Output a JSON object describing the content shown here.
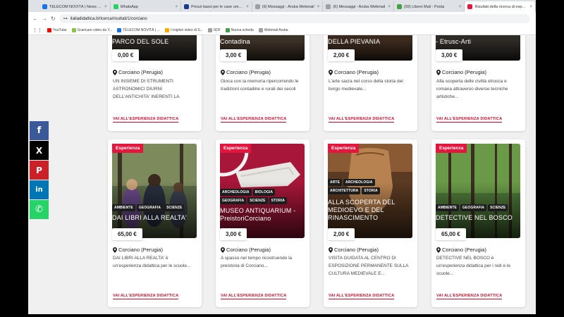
{
  "tabs": [
    {
      "title": "TELECOM NOVITÀ | News Espo...",
      "color": "#1a73e8",
      "active": false
    },
    {
      "title": "WhatsApp",
      "color": "#25d366",
      "active": false
    },
    {
      "title": "Prezzi bassi per le case umbri...",
      "color": "#1a3b8c",
      "active": false
    },
    {
      "title": "(6) Messaggi - Aruba Webmail",
      "color": "#9aa0a6",
      "active": false
    },
    {
      "title": "(6) Messaggi - Aruba Webmail",
      "color": "#9aa0a6",
      "active": false
    },
    {
      "title": "(59) Libero Mail - Posta",
      "color": "#43a047",
      "active": false
    },
    {
      "title": "Risultati della ricerca di esperi...",
      "color": "#e3173e",
      "active": true
    }
  ],
  "address": {
    "url": "italiadidattica.it/ricerca/risultati/1/corciano"
  },
  "bookmarks": [
    {
      "label": "YouTube",
      "color": "#ff0000"
    },
    {
      "label": "Scaricare video da Y...",
      "color": "#8bc34a"
    },
    {
      "label": "TELECOM NOVITÀ | ...",
      "color": "#1a73e8"
    },
    {
      "label": "I migliori video di S...",
      "color": "#f9ab00"
    },
    {
      "label": "SDF",
      "color": "#9e9e9e"
    },
    {
      "label": "Nuova scheda",
      "color": "#43a047"
    },
    {
      "label": "Webmail Aruba",
      "color": "#9aa0a6"
    }
  ],
  "share": [
    {
      "name": "facebook",
      "glyph": "f",
      "color": "#3b5998"
    },
    {
      "name": "x",
      "glyph": "X",
      "color": "#000000"
    },
    {
      "name": "pinterest",
      "glyph": "P",
      "color": "#cb2027"
    },
    {
      "name": "linkedin",
      "glyph": "in",
      "color": "#0077b5"
    },
    {
      "name": "whatsapp",
      "glyph": "✆",
      "color": "#25d366"
    }
  ],
  "cards": [
    {
      "title": "PARCO DEL SOLE",
      "price": "0,00 €",
      "location": "Corciano (Perugia)",
      "desc": "UN INSIEME DI STRUMENTI ASTRONOMICI DIURNI DELL'ANTICHITA' INERENTI LA",
      "cta": "VAI ALL'ESPERIENZA DIDATTICA",
      "img": "#2a2622"
    },
    {
      "title": "Contadina",
      "price": "3,00 €",
      "location": "Corciano (Perugia)",
      "desc": "Gioca con la memoria ripercorrendo le tradizioni contadine e rurali dei secoli",
      "cta": "VAI ALL'ESPERIENZA DIDATTICA",
      "img": "#3b3127"
    },
    {
      "title": "DELLA PIEVANIA",
      "price": "2,00 €",
      "location": "Corciano (Perugia)",
      "desc": "L'arte sacra nel corso della storia del borgo medievale...",
      "cta": "VAI ALL'ESPERIENZA DIDATTICA",
      "img": "#3a2a1e"
    },
    {
      "title": "- Etrusc-Arti",
      "price": "3,00 €",
      "location": "Corciano (Perugia)",
      "desc": "Alla scoperta delle civiltà etrusca e romana attraverso diverse tecniche artistiche...",
      "cta": "VAI ALL'ESPERIENZA DIDATTICA",
      "img": "#2e2a26"
    },
    {
      "badge": "Esperienza",
      "tags": [
        "AMBIENTE",
        "GEOGRAFIA",
        "SCIENZE"
      ],
      "title": "DAI LIBRI ALLA REALTA'",
      "price": "65,00 €",
      "location": "Corciano (Perugia)",
      "desc": "DAI LIBRI ALLA REALTA' è un'esperienza didattica per le scuole...",
      "cta": "VAI ALL'ESPERIENZA DIDATTICA",
      "img": "#4a5a3a"
    },
    {
      "badge": "Esperienza",
      "tags": [
        "ARCHEOLOGIA",
        "BIOLOGIA",
        "GEOGRAFIA",
        "SCIENZE",
        "STORIA"
      ],
      "title": "MUSEO ANTIQUARIUM - PreistoriCorciano",
      "price": "3,00 €",
      "location": "Corciano (Perugia)",
      "desc": "A spasso nel tempo ricostruendo la preistoria di Corciano...",
      "cta": "VAI ALL'ESPERIENZA DIDATTICA",
      "img": "#a8163a"
    },
    {
      "badge": "Esperienza",
      "tags": [
        "ARTE",
        "ARCHEOLOGIA",
        "ARCHITETTURA",
        "STORIA"
      ],
      "title": "ALLA SCOPERTA DEL MEDIOEVO E DEL RINASCIMENTO",
      "price": "2,00 €",
      "location": "Corciano (Perugia)",
      "desc": "VISITA GUIDATA AL CENTRO DI ESPOSIZIONE PERMANENTE SULLA CULTURA MEDIEVALE E...",
      "cta": "VAI ALL'ESPERIENZA DIDATTICA",
      "img": "#7a4a2a"
    },
    {
      "badge": "Esperienza",
      "tags": [
        "AMBIENTE",
        "GEOGRAFIA",
        "SCIENZE"
      ],
      "title": "DETECTIVE NEL BOSCO",
      "price": "65,00 €",
      "location": "Corciano (Perugia)",
      "desc": "DETECTIVE NEL BOSCO è un'esperienza didattica per i nidi e le scuole...",
      "cta": "VAI ALL'ESPERIENZA DIDATTICA",
      "img": "#3f6a30"
    }
  ]
}
